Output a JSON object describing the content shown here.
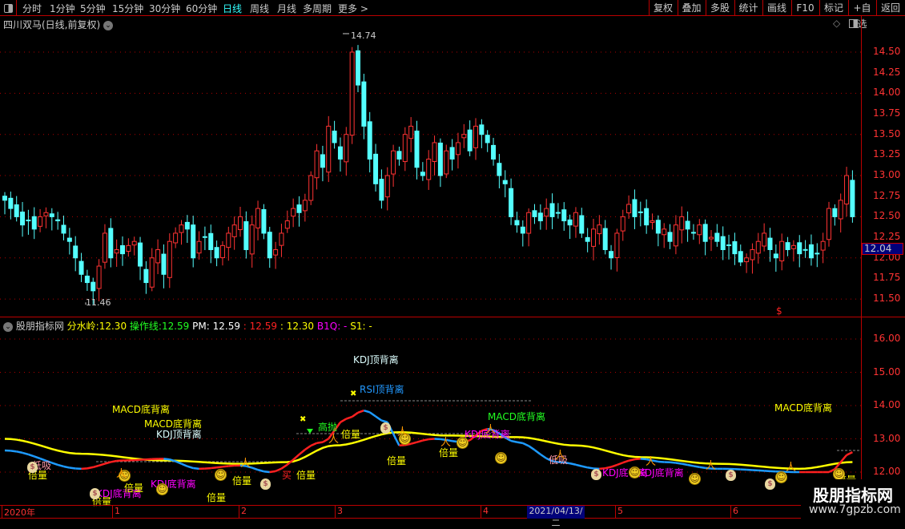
{
  "toolbar": {
    "tabs": [
      "分时",
      "1分钟",
      "5分钟",
      "15分钟",
      "30分钟",
      "60分钟",
      "日线",
      "周线",
      "月线",
      "多周期",
      "更多 >"
    ],
    "active": "日线",
    "buttons": [
      "复权",
      "叠加",
      "多股",
      "统计",
      "画线",
      "F10",
      "标记",
      "+自选",
      "返回"
    ]
  },
  "chart": {
    "title": "四川双马(日线,前复权)",
    "high_label": "14.74",
    "low_label": "11.46",
    "last_price": "12.04",
    "signal_mark": "$",
    "yticks": [
      "14.50",
      "14.25",
      "14.00",
      "13.75",
      "13.50",
      "13.25",
      "13.00",
      "12.75",
      "12.50",
      "12.25",
      "12.00",
      "11.75",
      "11.50"
    ],
    "closes": [
      12.7,
      12.6,
      12.5,
      12.4,
      12.45,
      12.35,
      12.5,
      12.55,
      12.5,
      12.45,
      12.3,
      12.2,
      12.0,
      11.8,
      11.7,
      11.6,
      11.9,
      12.3,
      12.0,
      12.1,
      12.05,
      12.15,
      12.2,
      11.9,
      11.7,
      12.0,
      12.1,
      11.8,
      12.2,
      12.3,
      12.4,
      12.35,
      12.0,
      12.2,
      12.25,
      12.1,
      12.0,
      12.15,
      12.3,
      12.4,
      12.5,
      12.1,
      12.4,
      12.6,
      12.3,
      12.0,
      12.1,
      12.3,
      12.45,
      12.6,
      12.55,
      12.7,
      13.0,
      13.3,
      13.1,
      13.6,
      13.4,
      13.2,
      13.5,
      14.5,
      14.1,
      13.6,
      13.2,
      12.9,
      12.7,
      13.0,
      13.3,
      13.2,
      13.5,
      13.6,
      13.1,
      13.0,
      13.2,
      13.4,
      13.0,
      13.3,
      13.2,
      13.4,
      13.5,
      13.3,
      13.6,
      13.5,
      13.4,
      13.2,
      13.0,
      12.9,
      12.5,
      12.4,
      12.3,
      12.55,
      12.5,
      12.45,
      12.6,
      12.5,
      12.55,
      12.45,
      12.4,
      12.55,
      12.3,
      12.2,
      12.35,
      12.4,
      12.1,
      12.0,
      12.3,
      12.5,
      12.65,
      12.5,
      12.55,
      12.4,
      12.45,
      12.3,
      12.35,
      12.2,
      12.4,
      12.5,
      12.35,
      12.3,
      12.4,
      12.2,
      12.25,
      12.2,
      12.1,
      12.15,
      12.05,
      11.95,
      12.0,
      12.1,
      12.2,
      12.3,
      12.1,
      12.0,
      12.2,
      12.1,
      12.15,
      12.05,
      12.1,
      12.0,
      12.05,
      12.2,
      12.6,
      12.5,
      12.7,
      13.0,
      12.5
    ]
  },
  "indicator": {
    "name": "股朋指标网",
    "fsl_label": "分水岭:",
    "fsl": "12.30",
    "czx_label": "操作线:",
    "czx": "12.59",
    "pm_label": "PM:",
    "pm": "12.59",
    "v1": ": 12.59",
    "v2": ": 12.30",
    "b1q": "B1Q: -",
    "s1": "S1: -",
    "yticks": [
      "16.00",
      "15.00",
      "14.00",
      "13.00",
      "12.00"
    ],
    "slow_line": [
      [
        0,
        13.0
      ],
      [
        13,
        12.55
      ],
      [
        27,
        12.35
      ],
      [
        40,
        12.25
      ],
      [
        48,
        12.3
      ],
      [
        56,
        12.8
      ],
      [
        67,
        13.2
      ],
      [
        75,
        13.1
      ],
      [
        87,
        13.05
      ],
      [
        97,
        12.8
      ],
      [
        108,
        12.45
      ],
      [
        121,
        12.25
      ],
      [
        135,
        12.1
      ],
      [
        144,
        12.3
      ]
    ],
    "fast_line": [
      [
        0,
        12.65
      ],
      [
        13,
        12.1
      ],
      [
        20,
        12.35
      ],
      [
        27,
        12.4
      ],
      [
        33,
        12.1
      ],
      [
        40,
        12.2
      ],
      [
        45,
        12.0
      ],
      [
        54,
        12.9
      ],
      [
        58,
        13.6
      ],
      [
        61,
        13.85
      ],
      [
        65,
        13.5
      ],
      [
        67,
        12.8
      ],
      [
        73,
        13.0
      ],
      [
        78,
        12.9
      ],
      [
        82,
        13.3
      ],
      [
        87,
        12.9
      ],
      [
        94,
        12.3
      ],
      [
        101,
        12.1
      ],
      [
        108,
        12.4
      ],
      [
        112,
        12.3
      ],
      [
        121,
        12.1
      ],
      [
        135,
        12.0
      ],
      [
        140,
        12.0
      ],
      [
        144,
        12.6
      ]
    ],
    "signals": {
      "macd1": "MACD底背离",
      "macd2": "MACD底背离",
      "kdj_top1": "KDJ顶背离",
      "kdj_top2": "KDJ顶背离",
      "rsi_top": "RSI顶背离",
      "macd3": "MACD底背离",
      "macd4": "MACD底背离",
      "kdj_bot1": "KDJ底背离",
      "kdj_bot2": "KDJ底背离",
      "kdj_bot3": "KDJ底背离",
      "kdj_bot4": "KDJ底背离",
      "kdj_bot5": "KDJ底背离",
      "gaopao": "高抛",
      "dixi1": "低吸",
      "dixi2": "低吸",
      "beiliang": "倍量",
      "mai": "买"
    }
  },
  "timeaxis": {
    "labels": [
      "2020年",
      "1",
      "2",
      "3",
      "4",
      "5",
      "6"
    ],
    "highlight": "2021/04/13/二"
  },
  "watermark": {
    "title": "股朋指标网",
    "url": "www.7gpzb.com"
  },
  "colors": {
    "up": "#ff3333",
    "down": "#54ffff",
    "slow": "#ffff00",
    "fast_up": "#ff2020",
    "fast_down": "#1e9bff",
    "grid": "#b00000"
  }
}
